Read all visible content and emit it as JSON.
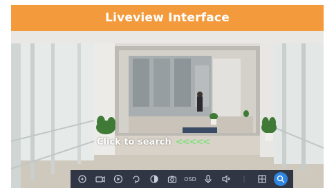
{
  "title": "Liveview Interface",
  "overlay": {
    "hint": "Click to search",
    "arrows": "<<<<<"
  },
  "toolbar": {
    "resolution_label": "OSD",
    "icons": [
      "target-icon",
      "camera-switch-icon",
      "playback-icon",
      "ptz-icon",
      "image-adjust-icon",
      "snapshot-icon",
      "osd-icon",
      "microphone-icon",
      "speaker-icon",
      "divider",
      "layout-grid-icon",
      "search-icon"
    ]
  },
  "colors": {
    "title_bar": "#f29a3c",
    "toolbar_bg": "#161e30",
    "active": "#2f86e0",
    "arrows": "#7fe07a"
  }
}
